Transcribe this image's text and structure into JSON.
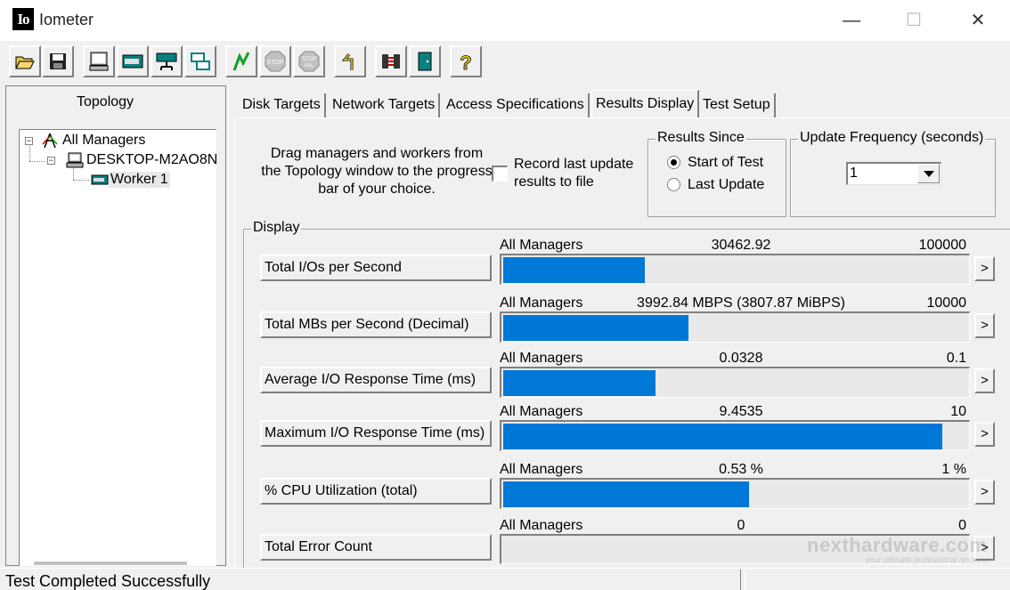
{
  "window": {
    "logo_text": "Io",
    "title": "Iometer",
    "controls": {
      "minimize": "—",
      "maximize": "☐",
      "close": "✕"
    }
  },
  "toolbar": {
    "buttons": [
      {
        "name": "open-config-icon"
      },
      {
        "name": "save-config-icon"
      },
      {
        "name": "start-manager-icon"
      },
      {
        "name": "start-disk-worker-icon"
      },
      {
        "name": "start-network-worker-icon"
      },
      {
        "name": "duplicate-worker-icon"
      },
      {
        "name": "start-tests-icon"
      },
      {
        "name": "stop-icon"
      },
      {
        "name": "stop-all-icon"
      },
      {
        "name": "reset-workers-icon"
      },
      {
        "name": "disconnect-icon"
      },
      {
        "name": "exit-icon"
      },
      {
        "name": "help-icon"
      }
    ],
    "stop_label": "STOP",
    "stop_all_label": "STOP",
    "stop_all_sub": "ALL"
  },
  "topology": {
    "title": "Topology",
    "root": "All Managers",
    "manager": "DESKTOP-M2AO8N",
    "worker": "Worker 1"
  },
  "tabs": [
    "Disk Targets",
    "Network Targets",
    "Access Specifications",
    "Results Display",
    "Test Setup"
  ],
  "active_tab": "Results Display",
  "results": {
    "drag_info": "Drag managers and workers from the Topology window to the progress bar of your choice.",
    "record_label": "Record last update results to file",
    "record_checked": false,
    "since_title": "Results Since",
    "since_options": [
      "Start of Test",
      "Last Update"
    ],
    "since_selected": "Start of Test",
    "freq_title": "Update Frequency (seconds)",
    "freq_value": "1",
    "display_title": "Display",
    "arrow_label": ">",
    "metrics": [
      {
        "label": "Total I/Os per Second",
        "source": "All Managers",
        "value": "30462.92",
        "max": "100000",
        "fraction": 0.3046
      },
      {
        "label": "Total MBs per Second (Decimal)",
        "source": "All Managers",
        "value": "3992.84 MBPS (3807.87 MiBPS)",
        "max": "10000",
        "fraction": 0.3993
      },
      {
        "label": "Average I/O Response Time (ms)",
        "source": "All Managers",
        "value": "0.0328",
        "max": "0.1",
        "fraction": 0.328
      },
      {
        "label": "Maximum I/O Response Time (ms)",
        "source": "All Managers",
        "value": "9.4535",
        "max": "10",
        "fraction": 0.9454
      },
      {
        "label": "% CPU Utilization (total)",
        "source": "All Managers",
        "value": "0.53 %",
        "max": "1 %",
        "fraction": 0.53
      },
      {
        "label": "Total Error Count",
        "source": "All Managers",
        "value": "0",
        "max": "0",
        "fraction": 0
      }
    ]
  },
  "status": {
    "text": "Test Completed Successfully"
  },
  "watermark": {
    "text": "nexthardware.com",
    "sub": "your ultimate professional resource"
  },
  "colors": {
    "bar": "#0078d7",
    "face": "#f0f0f0"
  }
}
